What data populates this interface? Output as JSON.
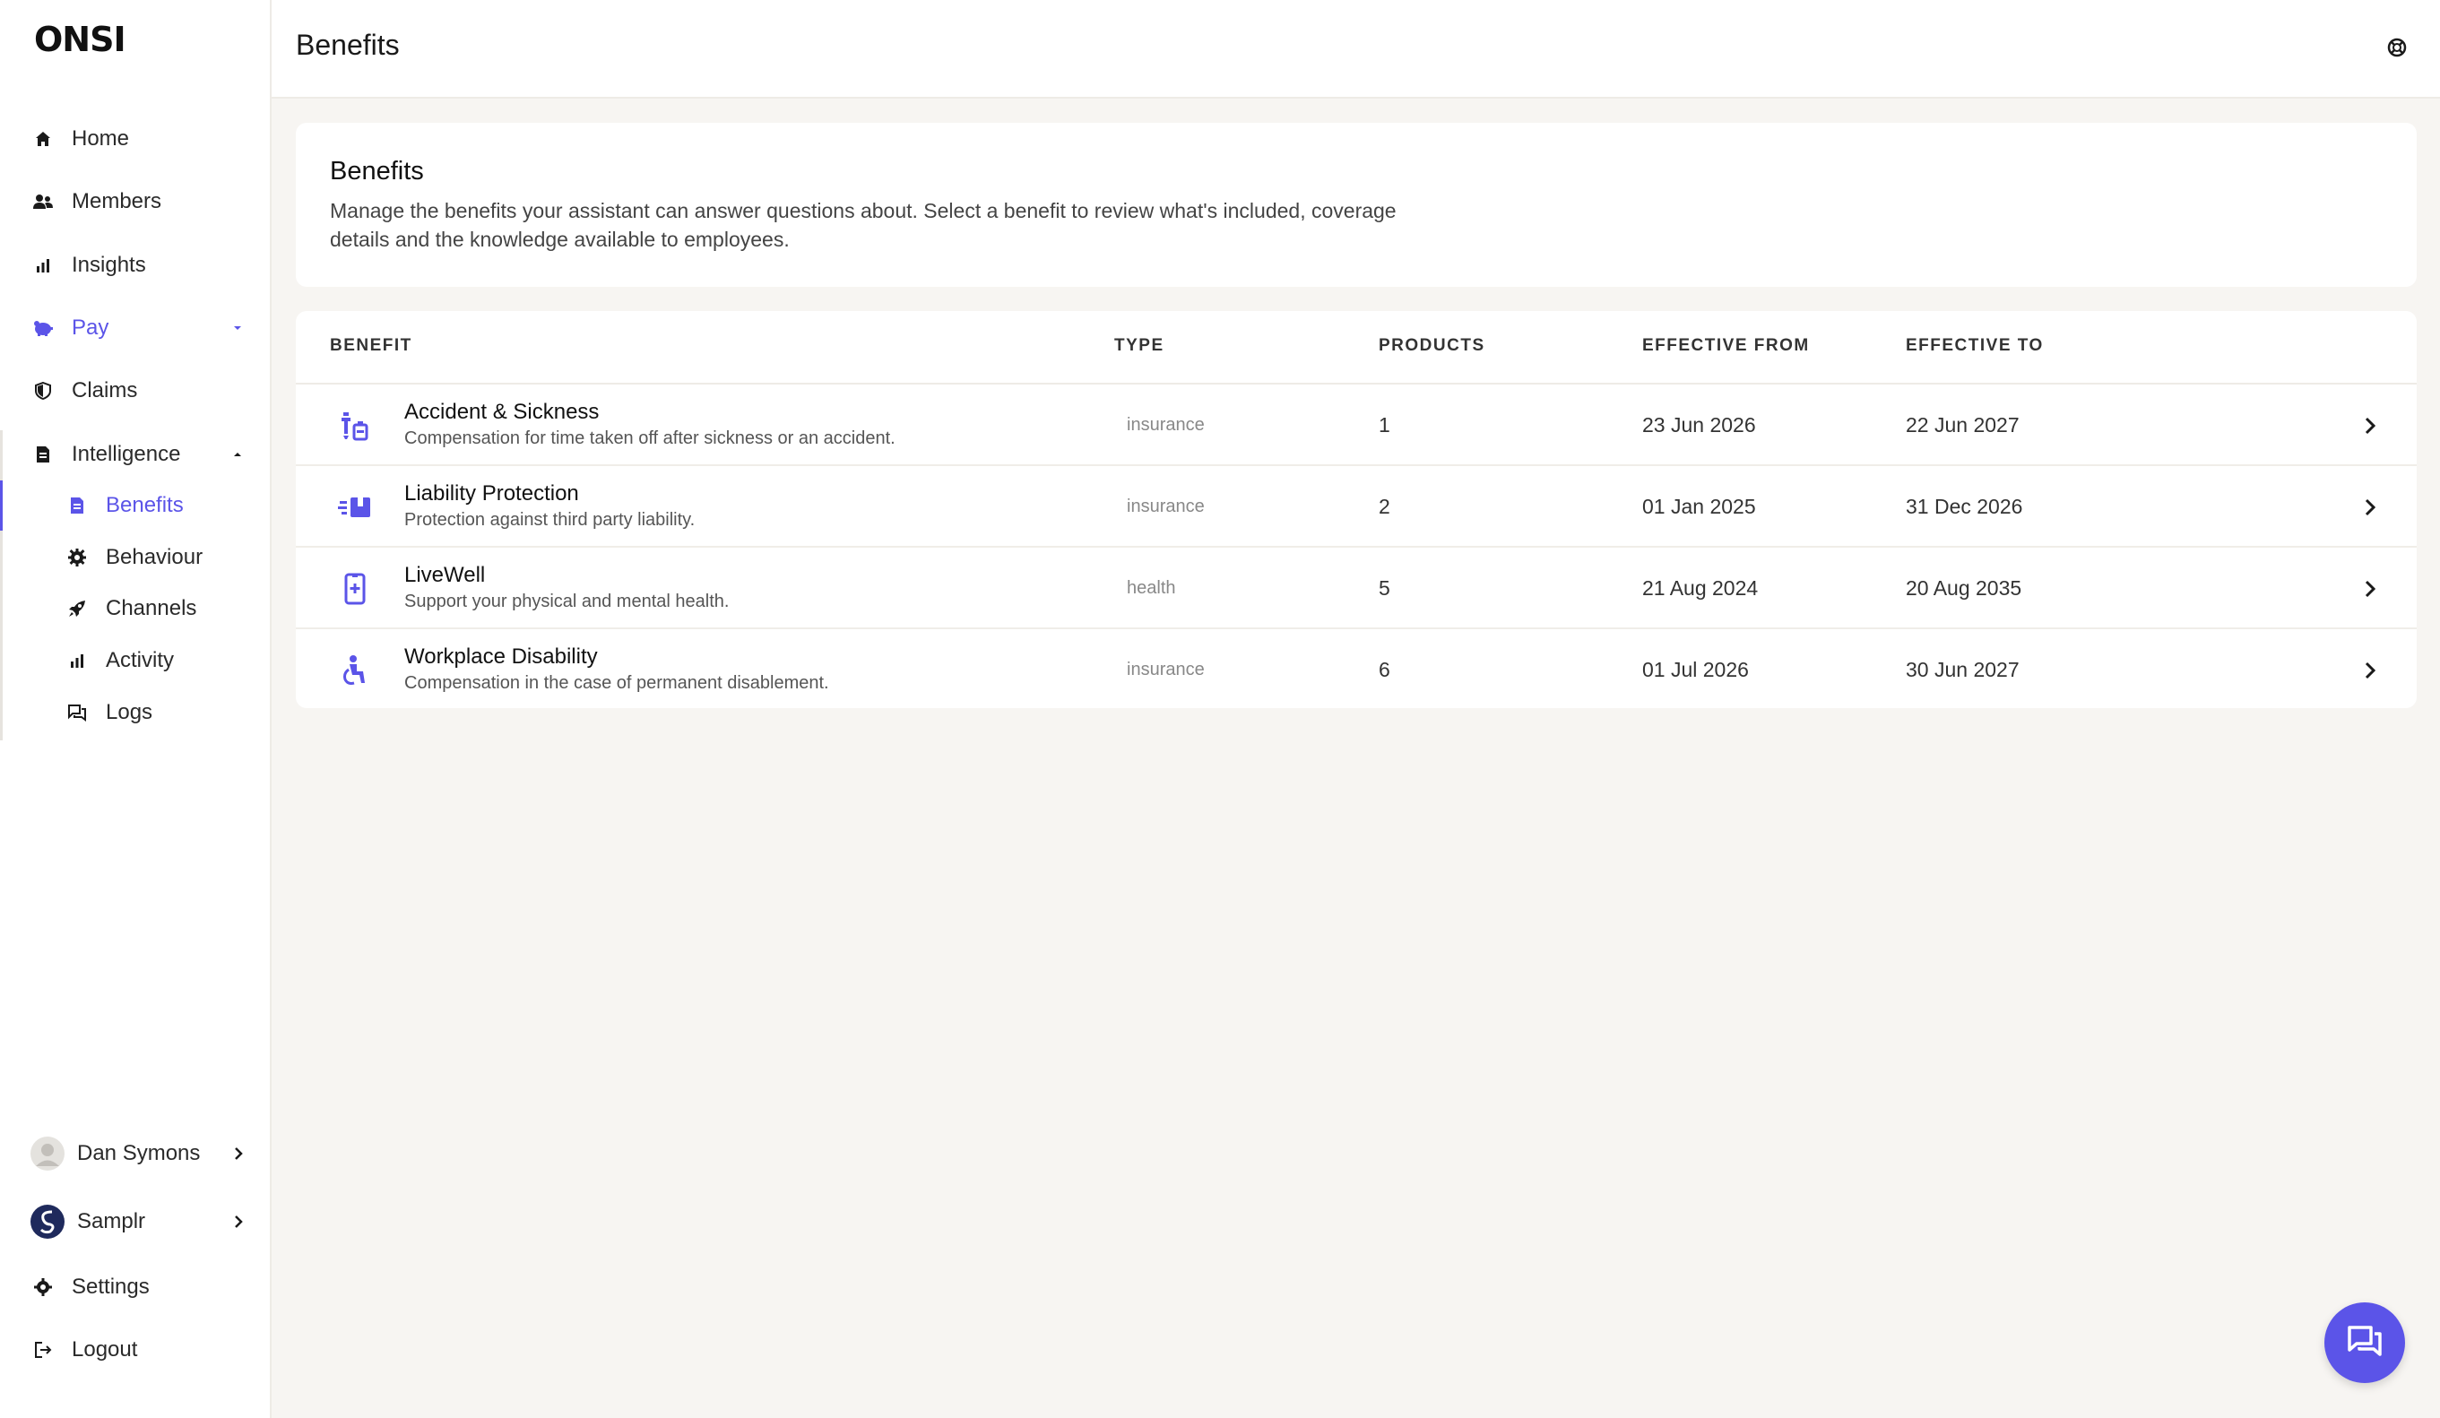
{
  "brand": {
    "logo": "ONSI",
    "accent": "#5b54e8"
  },
  "sidebar": {
    "items": [
      {
        "label": "Home",
        "icon": "home-icon"
      },
      {
        "label": "Members",
        "icon": "users-icon"
      },
      {
        "label": "Insights",
        "icon": "bar-chart-icon"
      },
      {
        "label": "Pay",
        "icon": "piggy-bank-icon",
        "expanded": false,
        "active": true
      },
      {
        "label": "Claims",
        "icon": "shield-icon"
      },
      {
        "label": "Intelligence",
        "icon": "document-icon",
        "expanded": true
      }
    ],
    "subitems": [
      {
        "label": "Benefits",
        "icon": "document-icon",
        "active": true
      },
      {
        "label": "Behaviour",
        "icon": "gear-icon"
      },
      {
        "label": "Channels",
        "icon": "rocket-icon"
      },
      {
        "label": "Activity",
        "icon": "bar-chart-icon"
      },
      {
        "label": "Logs",
        "icon": "chat-bubbles-icon"
      }
    ],
    "footer": {
      "user": "Dan Symons",
      "org": "Samplr",
      "settings": "Settings",
      "logout": "Logout"
    }
  },
  "header": {
    "title": "Benefits",
    "help_icon": "help-lifebuoy-icon"
  },
  "intro": {
    "title": "Benefits",
    "description": "Manage the benefits your assistant can answer questions about. Select a benefit to review what's included, coverage details and the knowledge available to employees."
  },
  "table": {
    "columns": [
      "BENEFIT",
      "TYPE",
      "PRODUCTS",
      "EFFECTIVE FROM",
      "EFFECTIVE TO"
    ],
    "rows": [
      {
        "name": "Accident & Sickness",
        "description": "Compensation for time taken off after sickness or an accident.",
        "type": "insurance",
        "products": "1",
        "from": "23 Jun 2026",
        "to": "22 Jun 2027",
        "icon": "medical-equipment-icon"
      },
      {
        "name": "Liability Protection",
        "description": "Protection against third party liability.",
        "type": "insurance",
        "products": "2",
        "from": "01 Jan 2025",
        "to": "31 Dec 2026",
        "icon": "fast-box-icon"
      },
      {
        "name": "LiveWell",
        "description": "Support your physical and mental health.",
        "type": "health",
        "products": "5",
        "from": "21 Aug 2024",
        "to": "20 Aug 2035",
        "icon": "phone-medical-icon"
      },
      {
        "name": "Workplace Disability",
        "description": "Compensation in the case of permanent disablement.",
        "type": "insurance",
        "products": "6",
        "from": "01 Jul 2026",
        "to": "30 Jun 2027",
        "icon": "accessibility-icon"
      }
    ]
  },
  "chat_fab": {
    "icon": "chat-icon"
  }
}
